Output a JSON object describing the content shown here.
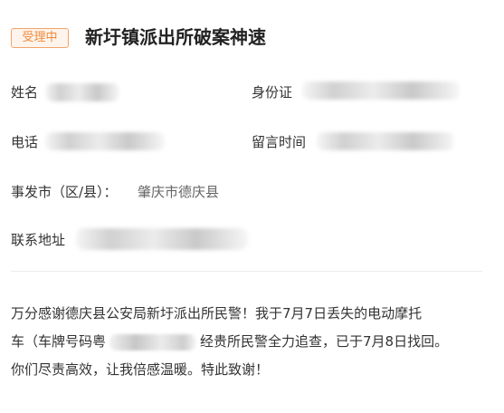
{
  "header": {
    "status_badge": "受理中",
    "title": "新圩镇派出所破案神速"
  },
  "fields": {
    "name_label": "姓名",
    "id_label": "身份证",
    "phone_label": "电话",
    "time_label": "留言时间",
    "district_label": "事发市（区/县）：",
    "district_value": "肇庆市德庆县",
    "address_label": "联系地址"
  },
  "message": {
    "line1": "万分感谢德庆县公安局新圩派出所民警！我于7月7日丢失的电动摩托",
    "line2_a": "车（车牌号码粤",
    "line2_b": "经贵所民警全力追查，已于7月8日找回。",
    "line3": "你们尽责高效，让我倍感温暖。特此致谢！"
  },
  "colors": {
    "badge_text": "#f08a3c",
    "badge_border": "#f3a46a",
    "badge_bg": "#fff4ec",
    "text": "#333333",
    "divider": "#ececec"
  }
}
